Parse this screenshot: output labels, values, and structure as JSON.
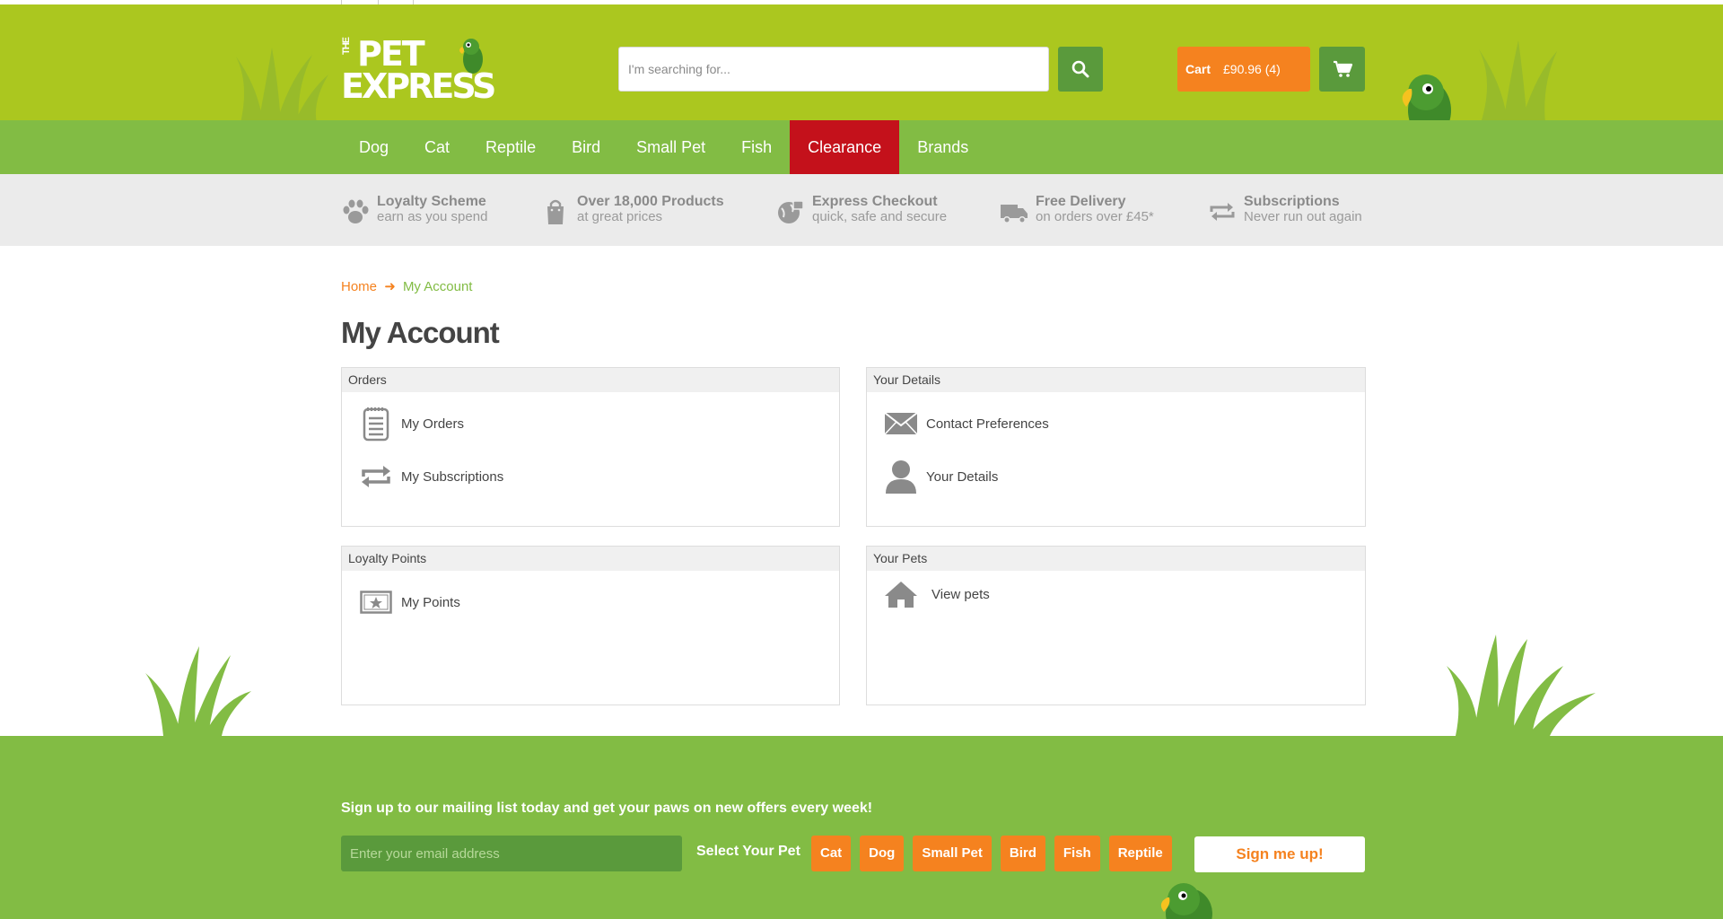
{
  "header": {
    "logo": {
      "the": "THE",
      "pet": "PET",
      "express": "EXPRESS"
    },
    "search": {
      "placeholder": "I'm searching for...",
      "icon": "search-icon"
    },
    "cart": {
      "label": "Cart",
      "summary": "£90.96 (4)",
      "icon": "cart-icon"
    }
  },
  "nav": {
    "items": [
      {
        "label": "Dog"
      },
      {
        "label": "Cat"
      },
      {
        "label": "Reptile"
      },
      {
        "label": "Bird"
      },
      {
        "label": "Small Pet"
      },
      {
        "label": "Fish"
      },
      {
        "label": "Clearance"
      },
      {
        "label": "Brands"
      }
    ]
  },
  "usp": {
    "items": [
      {
        "title": "Loyalty Scheme",
        "subtitle": "earn as you spend",
        "icon": "paw-icon"
      },
      {
        "title": "Over 18,000 Products",
        "subtitle": "at great prices",
        "icon": "shopping-bag-icon"
      },
      {
        "title": "Express Checkout",
        "subtitle": "quick, safe and secure",
        "icon": "secure-globe-icon"
      },
      {
        "title": "Free Delivery",
        "subtitle": "on orders over £45*",
        "icon": "delivery-truck-icon"
      },
      {
        "title": "Subscriptions",
        "subtitle": "Never run out again",
        "icon": "repeat-icon"
      }
    ]
  },
  "breadcrumb": {
    "home": "Home",
    "separator": "➜",
    "current": "My Account"
  },
  "page": {
    "title": "My Account"
  },
  "panels": {
    "orders": {
      "title": "Orders",
      "rows": [
        {
          "label": "My Orders",
          "icon": "order-list-icon"
        },
        {
          "label": "My Subscriptions",
          "icon": "repeat-icon"
        }
      ]
    },
    "details": {
      "title": "Your Details",
      "rows": [
        {
          "label": "Contact Preferences",
          "icon": "envelope-icon"
        },
        {
          "label": "Your Details",
          "icon": "user-icon"
        }
      ]
    },
    "loyalty": {
      "title": "Loyalty Points",
      "rows": [
        {
          "label": "My Points",
          "icon": "star-card-icon"
        }
      ]
    },
    "pets": {
      "title": "Your Pets",
      "rows": [
        {
          "label": "View pets",
          "icon": "house-icon"
        }
      ]
    }
  },
  "footer": {
    "mailing_text": "Sign up to our mailing list today and get your paws on new offers every week!",
    "email_placeholder": "Enter your email address",
    "select_pet": "Select Your Pet",
    "pets": [
      {
        "label": "Cat"
      },
      {
        "label": "Dog"
      },
      {
        "label": "Small Pet"
      },
      {
        "label": "Bird"
      },
      {
        "label": "Fish"
      },
      {
        "label": "Reptile"
      }
    ],
    "signup": "Sign me up!"
  },
  "colors": {
    "header_green": "#abc71f",
    "nav_green": "#82bc44",
    "dark_green": "#5a9a3c",
    "orange": "#f5821f",
    "clearance_red": "#c4111b",
    "usp_grey": "#ebebeb"
  }
}
